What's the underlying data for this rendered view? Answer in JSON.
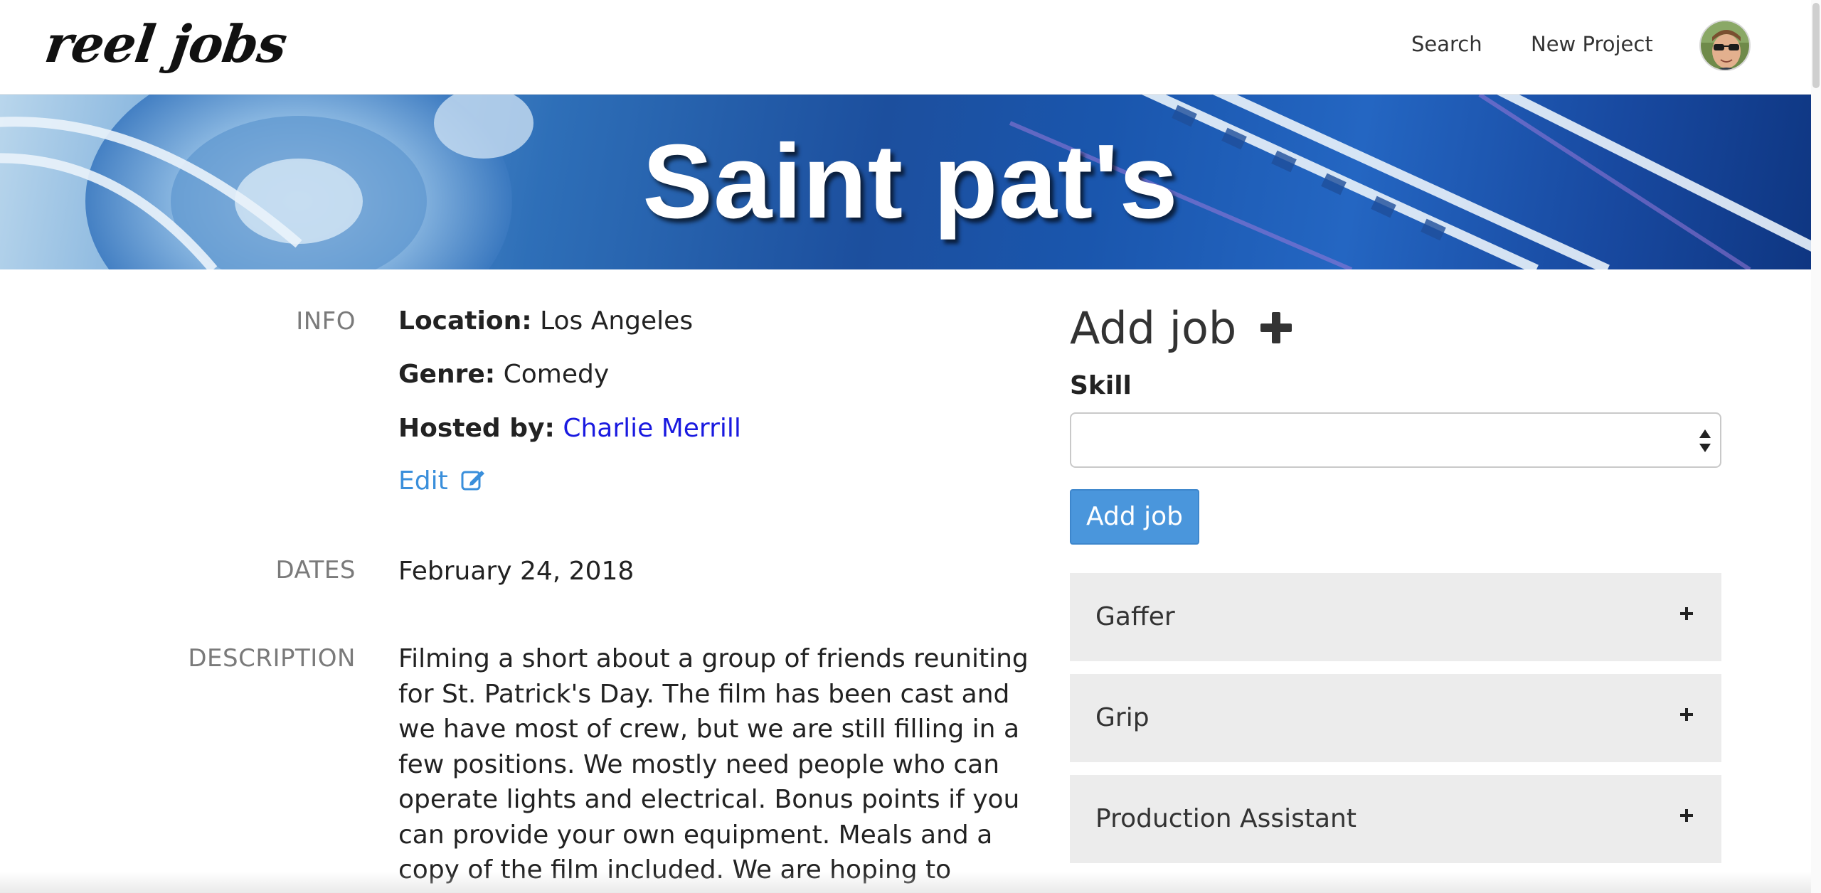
{
  "navbar": {
    "brand": "reel jobs",
    "links": {
      "search": "Search",
      "new_project": "New Project"
    },
    "avatar_icon": "user-avatar"
  },
  "banner": {
    "title": "Saint pat's"
  },
  "project": {
    "labels": {
      "info": "INFO",
      "dates": "DATES",
      "description": "DESCRIPTION"
    },
    "location_label": "Location:",
    "location": "Los Angeles",
    "genre_label": "Genre:",
    "genre": "Comedy",
    "hosted_label": "Hosted by:",
    "host": "Charlie Merrill",
    "edit_label": "Edit",
    "edit_icon": "edit-icon",
    "date": "February 24, 2018",
    "description": "Filming a short about a group of friends reuniting for St. Patrick's Day. The film has been cast and we have most of crew, but we are still filling in a few positions. We mostly need people who can operate lights and electrical. Bonus points if you can provide your own equipment. Meals and a copy of the film included. We are hoping to submit the film to festivals and get it"
  },
  "add_job": {
    "title": "Add job",
    "skill_label": "Skill",
    "skill_value": "",
    "button_label": "Add job"
  },
  "jobs": [
    {
      "label": "Gaffer"
    },
    {
      "label": "Grip"
    },
    {
      "label": "Production Assistant"
    }
  ],
  "colors": {
    "link_blue": "#1a1ae0",
    "edit_blue": "#3a8fdb",
    "button_blue": "#4a96dc",
    "job_item_bg": "#ececec"
  }
}
